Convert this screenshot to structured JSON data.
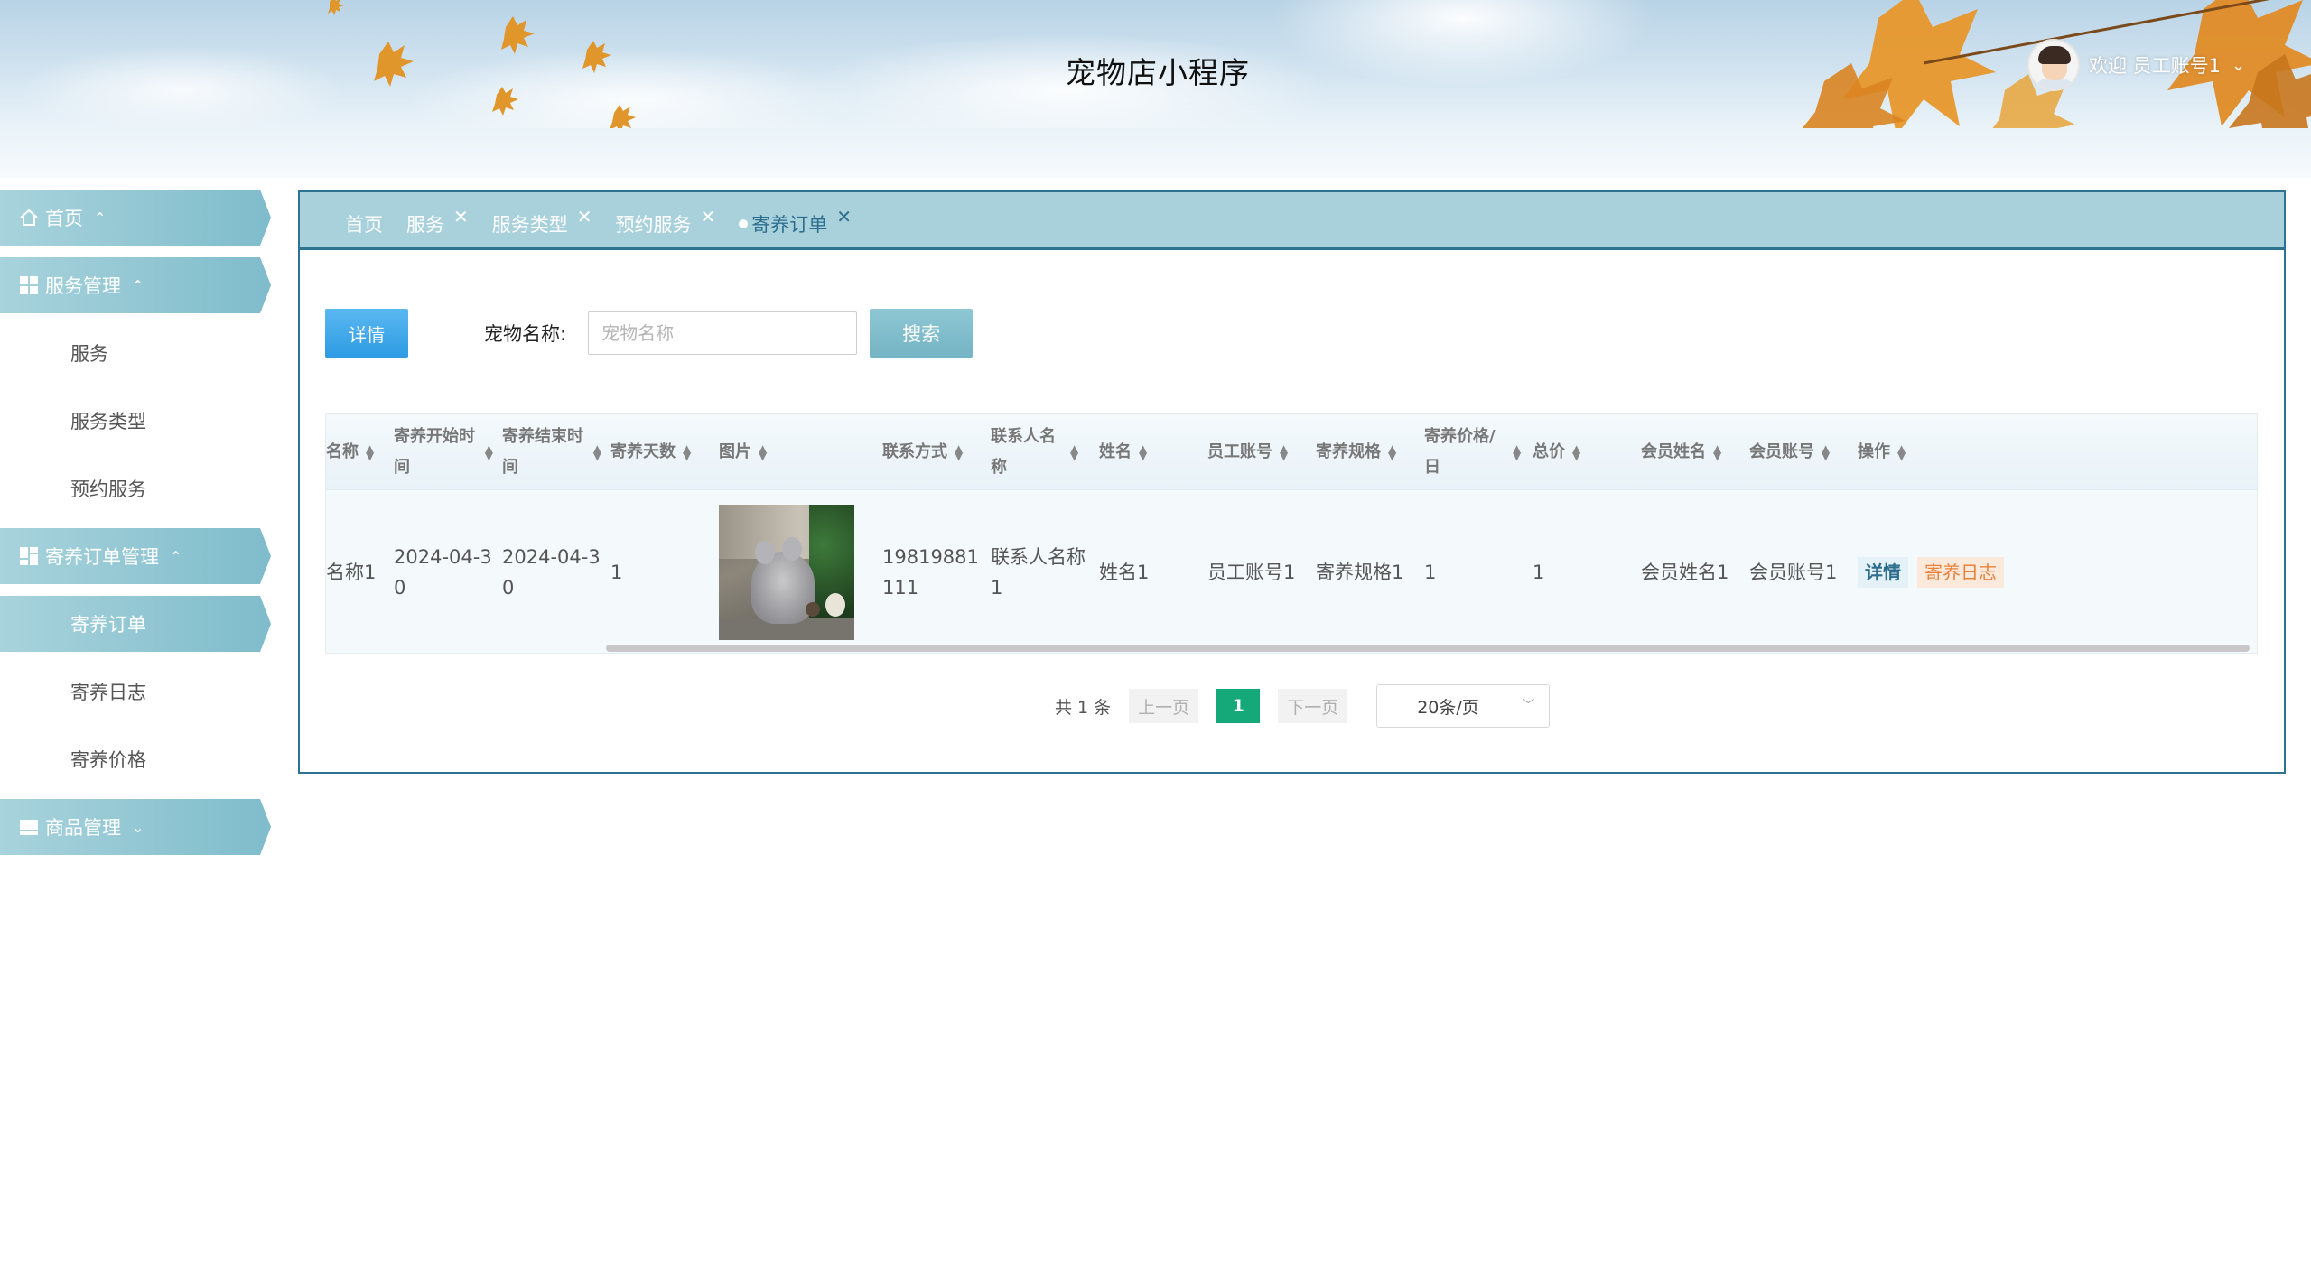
{
  "header": {
    "app_title": "宠物店小程序",
    "welcome_text": "欢迎 员工账号1"
  },
  "sidebar": {
    "groups": [
      {
        "label": "首页",
        "icon": "home-icon",
        "chevron": "chevron-up-icon"
      },
      {
        "label": "服务管理",
        "icon": "grid-icon",
        "chevron": "chevron-up-icon",
        "items": [
          "服务",
          "服务类型",
          "预约服务"
        ]
      },
      {
        "label": "寄养订单管理",
        "icon": "grid-icon",
        "chevron": "chevron-up-icon",
        "items": [
          "寄养订单",
          "寄养日志",
          "寄养价格"
        ],
        "active_item": "寄养订单"
      },
      {
        "label": "商品管理",
        "icon": "list-icon",
        "chevron": "chevron-down-icon"
      }
    ]
  },
  "tabs": [
    {
      "label": "首页",
      "closable": false
    },
    {
      "label": "服务",
      "closable": true
    },
    {
      "label": "服务类型",
      "closable": true
    },
    {
      "label": "预约服务",
      "closable": true
    },
    {
      "label": "寄养订单",
      "closable": true,
      "active": true
    }
  ],
  "toolbar": {
    "detail_button": "详情",
    "filter_label": "宠物名称:",
    "filter_placeholder": "宠物名称",
    "filter_value": "",
    "search_button": "搜索"
  },
  "table": {
    "columns": [
      {
        "key": "pet_name",
        "label": "宠物名称",
        "visible_label": "名称"
      },
      {
        "key": "start",
        "label": "寄养开始时间"
      },
      {
        "key": "end",
        "label": "寄养结束时间"
      },
      {
        "key": "days",
        "label": "寄养天数"
      },
      {
        "key": "image",
        "label": "图片"
      },
      {
        "key": "phone",
        "label": "联系方式"
      },
      {
        "key": "contact",
        "label": "联系人名称"
      },
      {
        "key": "name",
        "label": "姓名"
      },
      {
        "key": "staff",
        "label": "员工账号"
      },
      {
        "key": "spec",
        "label": "寄养规格"
      },
      {
        "key": "price",
        "label": "寄养价格/日"
      },
      {
        "key": "total",
        "label": "总价"
      },
      {
        "key": "member_name",
        "label": "会员姓名"
      },
      {
        "key": "member_account",
        "label": "会员账号"
      },
      {
        "key": "actions",
        "label": "操作"
      }
    ],
    "rows": [
      {
        "pet_name": "名称1",
        "start": "2024-04-30",
        "end": "2024-04-30",
        "days": "1",
        "phone": "19819881111",
        "contact": "联系人名称1",
        "name": "姓名1",
        "staff": "员工账号1",
        "spec": "寄养规格1",
        "price": "1",
        "total": "1",
        "member_name": "会员姓名1",
        "member_account": "会员账号1",
        "action_detail": "详情",
        "action_log": "寄养日志"
      }
    ]
  },
  "pagination": {
    "total_text": "共 1 条",
    "prev": "上一页",
    "current_page": "1",
    "next": "下一页",
    "page_size": "20条/页"
  },
  "colors": {
    "accent": "#2f7393",
    "tab_bar": "#a9d1dc",
    "sidebar": "#7fbccb",
    "detail_button": "#3aa6ea",
    "page_active": "#15a878",
    "log_link": "#e8823a"
  }
}
